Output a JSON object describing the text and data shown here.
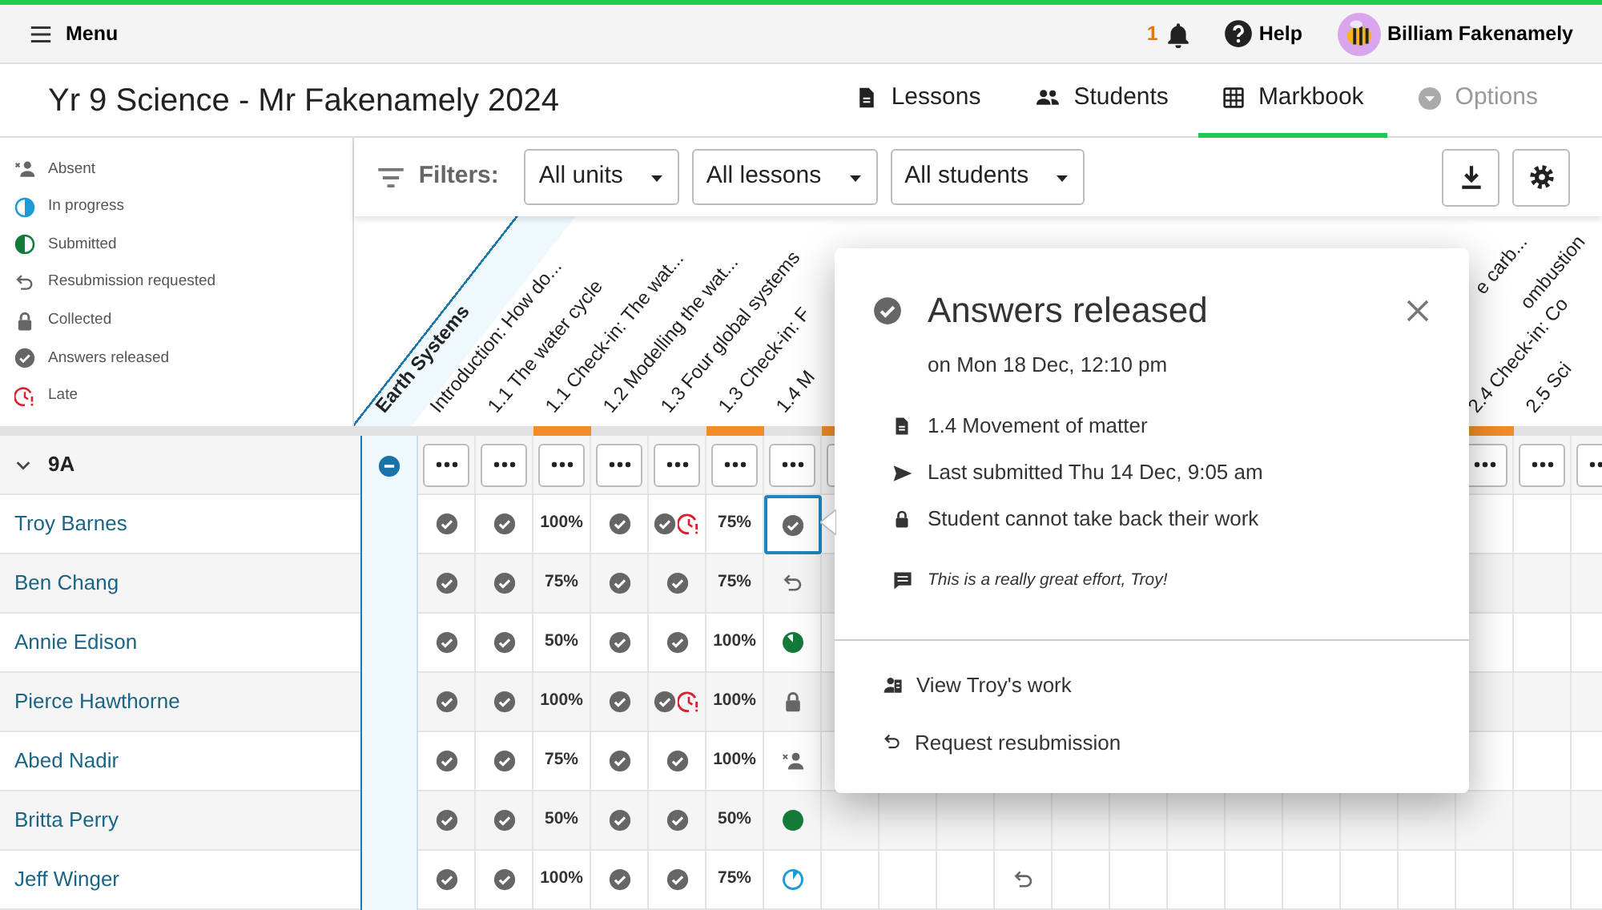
{
  "top_bar": {
    "menu_label": "Menu",
    "notification_count": "1",
    "help_label": "Help",
    "user_name": "Billiam Fakenamely"
  },
  "class_title": "Yr 9 Science - Mr Fakenamely 2024",
  "nav_tabs": [
    {
      "kind": "document",
      "label": "Lessons",
      "selected": false,
      "disabled": false
    },
    {
      "kind": "people",
      "label": "Students",
      "selected": false,
      "disabled": false
    },
    {
      "kind": "grid",
      "label": "Markbook",
      "selected": true,
      "disabled": false
    },
    {
      "kind": "caret",
      "label": "Options",
      "selected": false,
      "disabled": true
    }
  ],
  "legend": [
    {
      "kind": "absent",
      "label": "Absent"
    },
    {
      "kind": "in_progress",
      "label": "In progress"
    },
    {
      "kind": "submitted",
      "label": "Submitted"
    },
    {
      "kind": "resubmit",
      "label": "Resubmission requested"
    },
    {
      "kind": "collected",
      "label": "Collected"
    },
    {
      "kind": "released",
      "label": "Answers released"
    },
    {
      "kind": "late",
      "label": "Late"
    }
  ],
  "filters": {
    "label": "Filters:",
    "selects": [
      {
        "value": "All units"
      },
      {
        "value": "All lessons"
      },
      {
        "value": "All students"
      }
    ]
  },
  "unit": {
    "label": "Earth Systems"
  },
  "columns": [
    {
      "label": "Introduction: How do...",
      "kind": "lesson"
    },
    {
      "label": "1.1 The water cycle",
      "kind": "lesson"
    },
    {
      "label": "1.1 Check-in: The wat...",
      "kind": "check_in"
    },
    {
      "label": "1.2 Modelling the wat...",
      "kind": "lesson"
    },
    {
      "label": "1.3 Four global systems",
      "kind": "lesson"
    },
    {
      "label": "1.3 Check-in: F",
      "kind": "check_in"
    },
    {
      "label": "1.4 M",
      "kind": "lesson"
    },
    {
      "kind": "check_in"
    },
    {
      "kind": "covered"
    },
    {
      "kind": "covered"
    },
    {
      "kind": "covered"
    },
    {
      "kind": "covered"
    },
    {
      "kind": "covered"
    },
    {
      "kind": "covered"
    },
    {
      "kind": "covered"
    },
    {
      "kind": "covered"
    },
    {
      "label_end": "e carb...",
      "kind": "covered"
    },
    {
      "label_end": "ombustion",
      "kind": "covered"
    },
    {
      "label": "2.4 Check-in: Co",
      "kind": "check_in"
    },
    {
      "label": "2.5 Sci",
      "kind": "lesson"
    },
    {
      "kind": "lesson"
    }
  ],
  "group": {
    "label": "9A",
    "expanded": true
  },
  "students": [
    {
      "name": "Troy Barnes",
      "cells": [
        {
          "kind": "released",
          "selected": false
        },
        {
          "kind": "released",
          "selected": false
        },
        {
          "kind": "score",
          "text": "100%",
          "selected": false
        },
        {
          "kind": "released",
          "selected": false
        },
        {
          "kind": "late",
          "selected": false
        },
        {
          "kind": "score",
          "text": "75%",
          "selected": false
        },
        {
          "kind": "released",
          "selected": true
        }
      ]
    },
    {
      "name": "Ben Chang",
      "cells": [
        {
          "kind": "released",
          "selected": false
        },
        {
          "kind": "released",
          "selected": false
        },
        {
          "kind": "score",
          "text": "75%",
          "selected": false
        },
        {
          "kind": "released",
          "selected": false
        },
        {
          "kind": "released",
          "selected": false
        },
        {
          "kind": "score",
          "text": "75%",
          "selected": false
        },
        {
          "kind": "resubmit",
          "selected": false
        }
      ]
    },
    {
      "name": "Annie Edison",
      "cells": [
        {
          "kind": "released",
          "selected": false
        },
        {
          "kind": "released",
          "selected": false
        },
        {
          "kind": "score",
          "text": "50%",
          "selected": false
        },
        {
          "kind": "released",
          "selected": false
        },
        {
          "kind": "released",
          "selected": false
        },
        {
          "kind": "score",
          "text": "100%",
          "selected": false
        },
        {
          "kind": "submitted",
          "complete": false,
          "selected": false
        }
      ]
    },
    {
      "name": "Pierce Hawthorne",
      "cells": [
        {
          "kind": "released",
          "selected": false
        },
        {
          "kind": "released",
          "selected": false
        },
        {
          "kind": "score",
          "text": "100%",
          "selected": false
        },
        {
          "kind": "released",
          "selected": false
        },
        {
          "kind": "late",
          "selected": false
        },
        {
          "kind": "score",
          "text": "100%",
          "selected": false
        },
        {
          "kind": "collected",
          "selected": false
        }
      ]
    },
    {
      "name": "Abed Nadir",
      "cells": [
        {
          "kind": "released",
          "selected": false
        },
        {
          "kind": "released",
          "selected": false
        },
        {
          "kind": "score",
          "text": "75%",
          "selected": false
        },
        {
          "kind": "released",
          "selected": false
        },
        {
          "kind": "released",
          "selected": false
        },
        {
          "kind": "score",
          "text": "100%",
          "selected": false
        },
        {
          "kind": "absent",
          "selected": false
        }
      ]
    },
    {
      "name": "Britta Perry",
      "cells": [
        {
          "kind": "released",
          "selected": false
        },
        {
          "kind": "released",
          "selected": false
        },
        {
          "kind": "score",
          "text": "50%",
          "selected": false
        },
        {
          "kind": "released",
          "selected": false
        },
        {
          "kind": "released",
          "selected": false
        },
        {
          "kind": "score",
          "text": "50%",
          "selected": false
        },
        {
          "kind": "submitted",
          "complete": true,
          "selected": false
        }
      ]
    },
    {
      "name": "Jeff Winger",
      "cells": [
        {
          "kind": "released",
          "selected": false
        },
        {
          "kind": "released",
          "selected": false
        },
        {
          "kind": "score",
          "text": "100%",
          "selected": false
        },
        {
          "kind": "released",
          "selected": false
        },
        {
          "kind": "released",
          "selected": false
        },
        {
          "kind": "score",
          "text": "75%",
          "selected": false
        },
        {
          "kind": "in_progress",
          "selected": false
        },
        {
          "kind": "blank"
        },
        {
          "kind": "blank"
        },
        {
          "kind": "blank"
        },
        {
          "kind": "resubmit",
          "selected": false
        }
      ]
    }
  ],
  "popover": {
    "title": "Answers released",
    "subtitle": "on Mon 18 Dec, 12:10 pm",
    "details": [
      {
        "kind": "lesson",
        "text": "1.4 Movement of matter"
      },
      {
        "kind": "sent",
        "text": "Last submitted Thu 14 Dec, 9:05 am"
      },
      {
        "kind": "locked",
        "text": "Student cannot take back their work"
      },
      {
        "kind": "comment",
        "text": "This is a really great effort, Troy!"
      }
    ],
    "actions": [
      {
        "kind": "view",
        "label": "View Troy's work"
      },
      {
        "kind": "resubmit",
        "label": "Request resubmission"
      }
    ]
  }
}
